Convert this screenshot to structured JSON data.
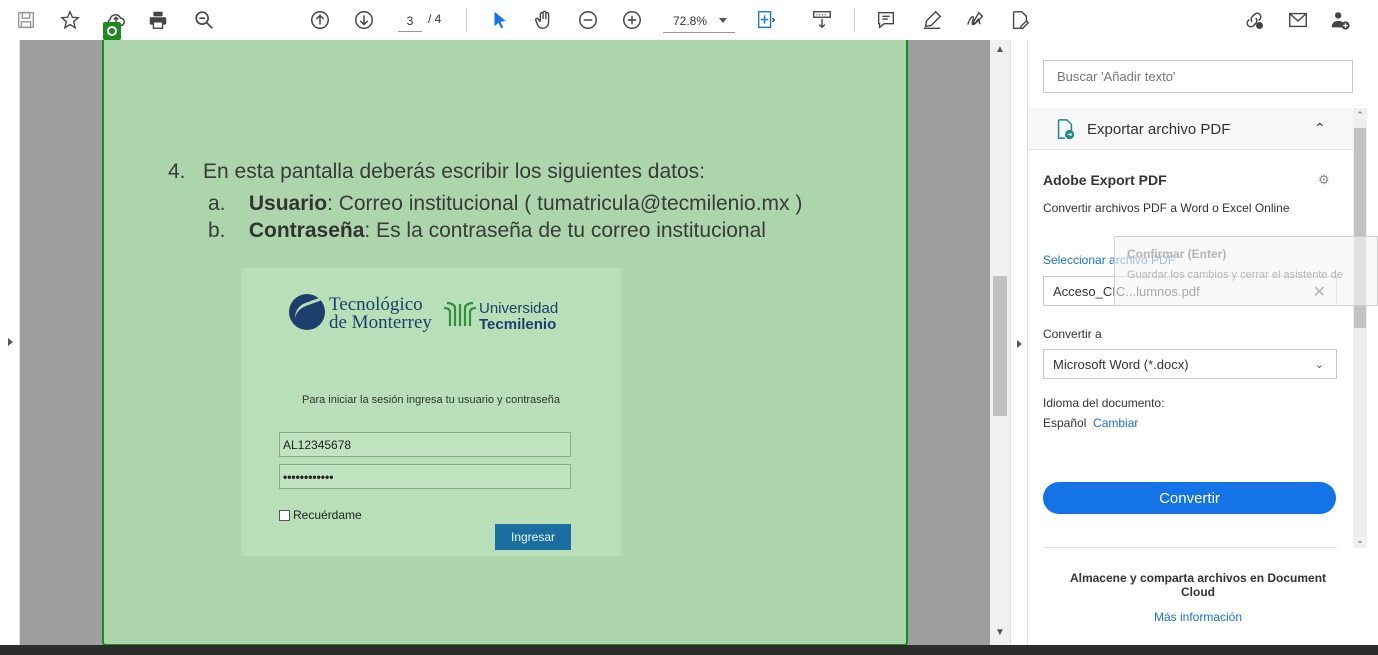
{
  "toolbar": {
    "page_current": "3",
    "page_total": "/ 4",
    "zoom": "72.8%",
    "icons": [
      "save-icon",
      "bookmark-star-icon",
      "cloud-upload-icon",
      "print-icon",
      "zoom-search-icon",
      "page-up-icon",
      "page-down-icon",
      "select-cursor-icon",
      "hand-icon",
      "zoom-out-icon",
      "zoom-in-icon",
      "fit-page-icon",
      "scroll-mode-icon",
      "comment-icon",
      "highlight-icon",
      "sign-icon",
      "fill-sign-icon",
      "share-link-icon",
      "email-icon",
      "add-user-icon"
    ]
  },
  "document": {
    "step_number": "4.",
    "step_text": "En esta pantalla deberás escribir los siguientes datos:",
    "item_a_letter": "a.",
    "item_a_bold": "Usuario",
    "item_a_text": ": Correo institucional ( tumatricula@tecmilenio.mx )",
    "item_b_letter": "b.",
    "item_b_bold": "Contraseña",
    "item_b_text": ": Es la contraseña de tu correo institucional",
    "login": {
      "logo1_line1": "Tecnológico",
      "logo1_line2": "de Monterrey",
      "logo2_line1": "Universidad",
      "logo2_line2": "Tecmilenio",
      "instruction": "Para iniciar la sesión ingresa tu usuario y contraseña",
      "username": "AL12345678",
      "password": "••••••••••••",
      "remember": "Recuérdame",
      "submit": "Ingresar"
    }
  },
  "right_pane": {
    "search_placeholder": "Buscar 'Añadir texto'",
    "export_title": "Exportar archivo PDF",
    "section_title": "Adobe Export PDF",
    "section_desc": "Convertir archivos PDF a Word o Excel Online",
    "select_file_link": "Seleccionar archivo PDF",
    "file_name": "Acceso_CIC...lumnos.pdf",
    "convert_to_label": "Convertir a",
    "convert_to_value": "Microsoft Word (*.docx)",
    "doc_language_label": "Idioma del documento:",
    "doc_language_value": "Español",
    "change_link": "Cambiar",
    "convert_button": "Convertir",
    "cloud_text": "Almacene y comparta archivos en Document Cloud",
    "more_info_link": "Más información"
  },
  "tooltip": {
    "title": "Confirmar (Enter)",
    "desc": "Guardar los cambios y cerrar el asistente de"
  },
  "colors": {
    "page_bg": "#acd5ac",
    "page_border": "#1e8a1e",
    "accent": "#1473e6",
    "login_button": "#1b6fa0"
  }
}
